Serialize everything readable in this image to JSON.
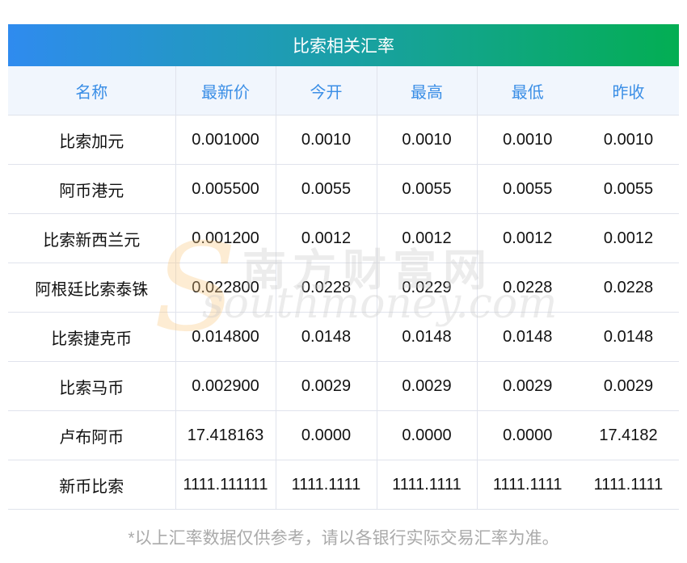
{
  "title": "比索相关汇率",
  "columns": [
    "名称",
    "最新价",
    "今开",
    "最高",
    "最低",
    "昨收"
  ],
  "rows": [
    [
      "比索加元",
      "0.001000",
      "0.0010",
      "0.0010",
      "0.0010",
      "0.0010"
    ],
    [
      "阿币港元",
      "0.005500",
      "0.0055",
      "0.0055",
      "0.0055",
      "0.0055"
    ],
    [
      "比索新西兰元",
      "0.001200",
      "0.0012",
      "0.0012",
      "0.0012",
      "0.0012"
    ],
    [
      "阿根廷比索泰铢",
      "0.022800",
      "0.0228",
      "0.0229",
      "0.0228",
      "0.0228"
    ],
    [
      "比索捷克币",
      "0.014800",
      "0.0148",
      "0.0148",
      "0.0148",
      "0.0148"
    ],
    [
      "比索马币",
      "0.002900",
      "0.0029",
      "0.0029",
      "0.0029",
      "0.0029"
    ],
    [
      "卢布阿币",
      "17.418163",
      "0.0000",
      "0.0000",
      "0.0000",
      "17.4182"
    ],
    [
      "新币比索",
      "1111.111111",
      "1111.1111",
      "1111.1111",
      "1111.1111",
      "1111.1111"
    ]
  ],
  "watermark": {
    "cn": "南方财富网",
    "en": "southmoney.com"
  },
  "footer": "*以上汇率数据仅供参考，请以各银行实际交易汇率为准。"
}
